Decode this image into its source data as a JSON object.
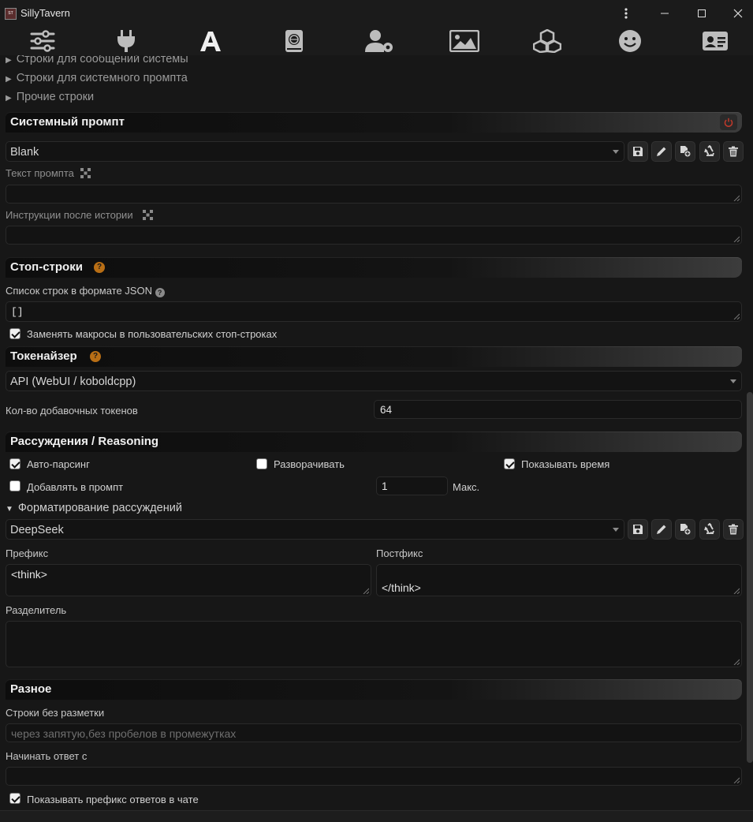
{
  "window": {
    "title": "SillyTavern",
    "logo": "ST"
  },
  "toolbar": {
    "icons": [
      "sliders-icon",
      "plug-icon",
      "font-a-icon",
      "book-globe-icon",
      "user-gear-icon",
      "image-icon",
      "cubes-icon",
      "smile-icon",
      "id-card-icon"
    ],
    "active": "font-a-icon"
  },
  "sections": {
    "collapsed": [
      "Строки для сообщений системы",
      "Строки для системного промпта",
      "Прочие строки"
    ],
    "system_prompt": {
      "title": "Системный промпт",
      "selected": "Blank",
      "prompt_text_label": "Текст промпта",
      "post_history_label": "Инструкции после истории"
    },
    "stop_strings": {
      "title": "Стоп-строки",
      "help": "?",
      "json_label": "Список строк в формате JSON",
      "json_value": "[]",
      "replace_macros_label": "Заменять макросы в пользовательских стоп-строках",
      "replace_macros_checked": true
    },
    "tokenizer": {
      "title": "Токенайзер",
      "help": "?",
      "selected": "API (WebUI / koboldcpp)",
      "extra_tokens_label": "Кол-во добавочных токенов",
      "extra_tokens_value": "64"
    },
    "reasoning": {
      "title": "Рассуждения / Reasoning",
      "auto_parse_label": "Авто-парсинг",
      "auto_parse_checked": true,
      "expand_label": "Разворачивать",
      "expand_checked": false,
      "show_time_label": "Показывать время",
      "show_time_checked": true,
      "add_to_prompt_label": "Добавлять в промпт",
      "add_to_prompt_checked": false,
      "max_value": "1",
      "max_label": "Макс.",
      "formatting_label": "Форматирование рассуждений",
      "formatting_selected": "DeepSeek",
      "prefix_label": "Префикс",
      "prefix_value": "<think>",
      "postfix_label": "Постфикс",
      "postfix_value": "</think>",
      "separator_label": "Разделитель"
    },
    "misc": {
      "title": "Разное",
      "no_markdown_label": "Строки без разметки",
      "no_markdown_placeholder": "через запятую,без пробелов в промежутках",
      "start_reply_label": "Начинать ответ с",
      "show_prefix_label": "Показывать префикс ответов в чате",
      "show_prefix_checked": true
    }
  },
  "colors": {
    "accent": "#b86e15",
    "power": "#c0392b",
    "background": "#171717"
  }
}
